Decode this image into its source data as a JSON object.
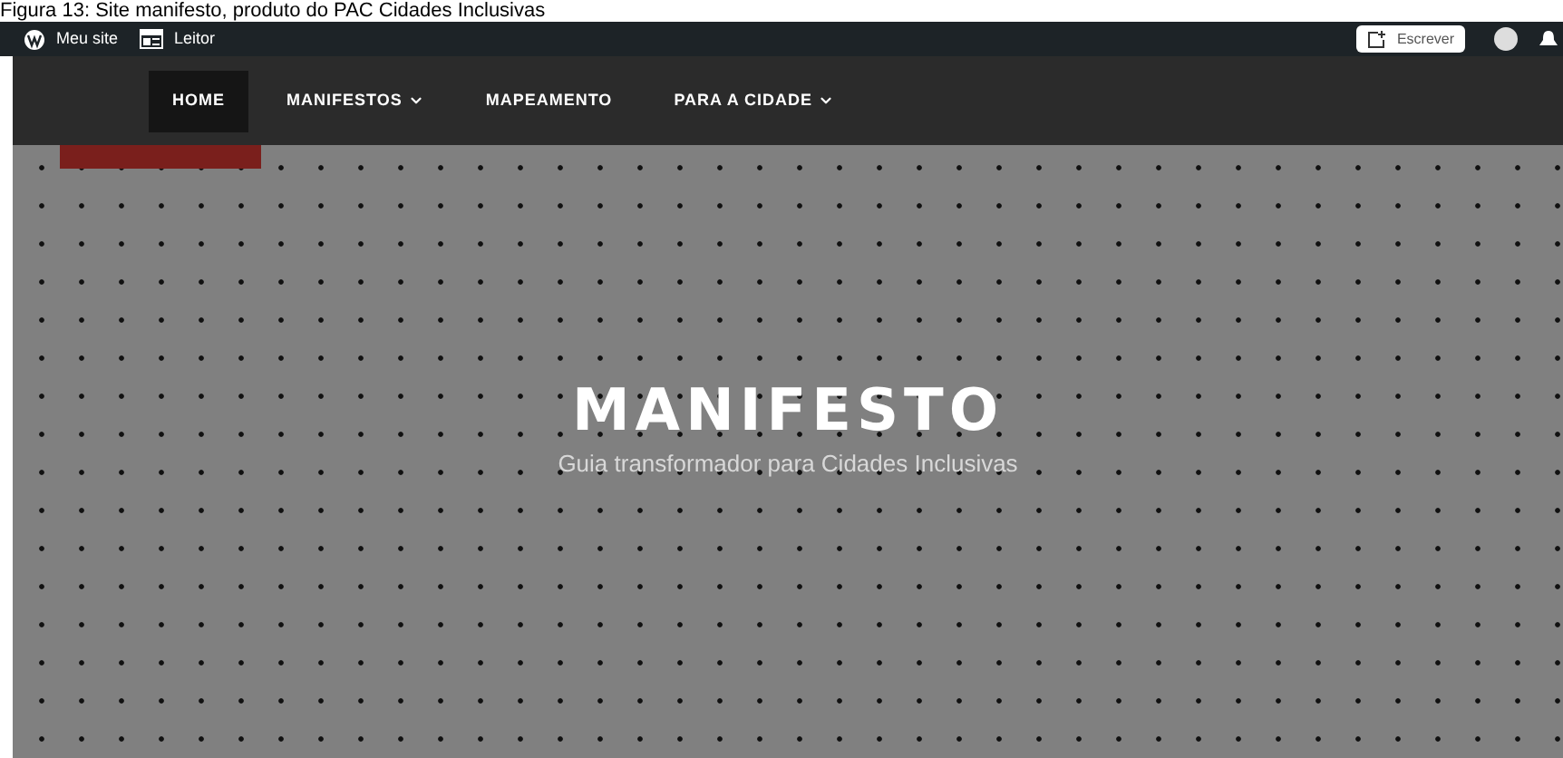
{
  "caption": "Figura 13: Site manifesto, produto do PAC Cidades Inclusivas",
  "admin_bar": {
    "items": [
      {
        "kind": "wordpress",
        "label": "Meu site"
      },
      {
        "kind": "reader",
        "label": "Leitor"
      }
    ],
    "write_button": "Escrever"
  },
  "nav": [
    {
      "label": "HOME",
      "selected": true,
      "dropdown": false
    },
    {
      "label": "MANIFESTOS",
      "selected": false,
      "dropdown": true
    },
    {
      "label": "MAPEAMENTO",
      "selected": false,
      "dropdown": false
    },
    {
      "label": "PARA A CIDADE",
      "selected": false,
      "dropdown": true
    }
  ],
  "hero": {
    "title": "MANIFESTO",
    "subtitle": "Guia transformador para Cidades Inclusivas"
  }
}
